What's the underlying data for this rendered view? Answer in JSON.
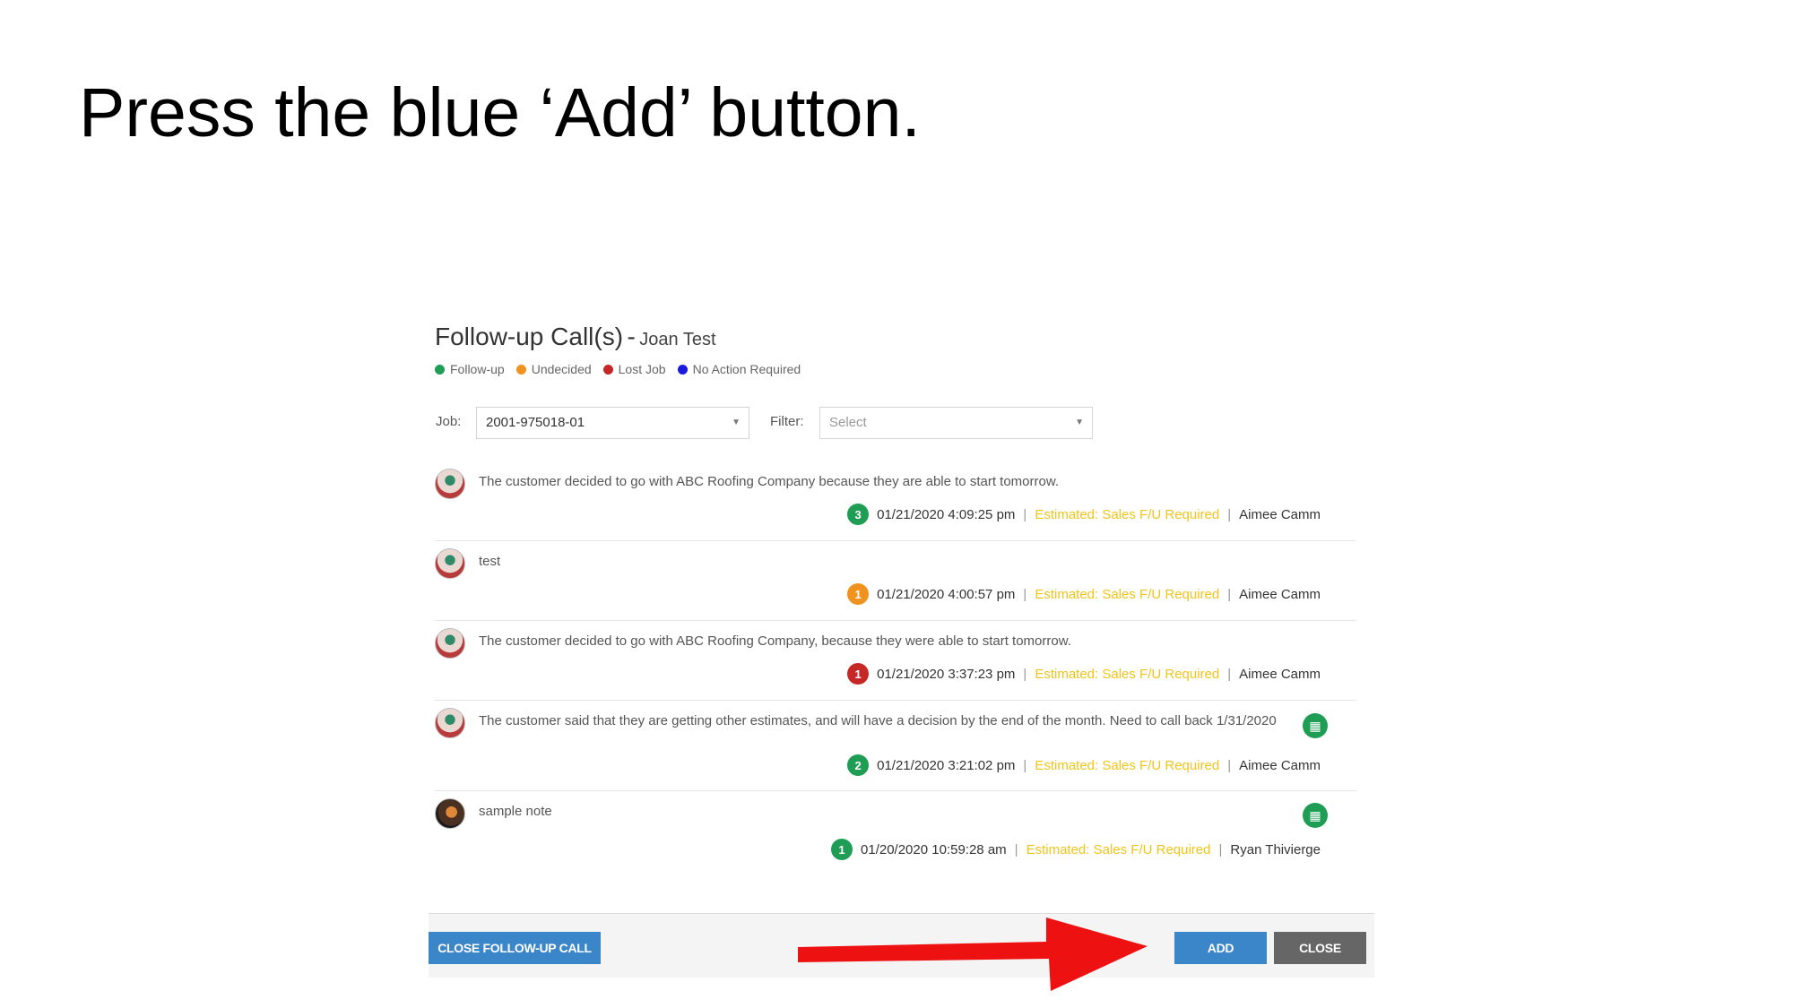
{
  "slide": {
    "instruction": "Press the blue ‘Add’ button."
  },
  "modal": {
    "title": "Follow-up Call(s)",
    "separator": "-",
    "customer": "Joan Test",
    "legend": [
      {
        "label": "Follow-up",
        "color": "#1f9d55"
      },
      {
        "label": "Undecided",
        "color": "#f0931e"
      },
      {
        "label": "Lost Job",
        "color": "#c62828"
      },
      {
        "label": "No Action Required",
        "color": "#1a1ae0"
      }
    ],
    "job": {
      "label": "Job:",
      "value": "2001-975018-01"
    },
    "filter": {
      "label": "Filter:",
      "placeholder": "Select"
    },
    "notes": [
      {
        "text": "The customer decided to go with ABC Roofing Company because they are able to start tomorrow.",
        "badge": "3",
        "badge_color": "#1f9d55",
        "timestamp": "01/21/2020 4:09:25 pm",
        "status": "Estimated: Sales F/U Required",
        "author": "Aimee Camm",
        "calendar": false,
        "avatar": "avatar-icon"
      },
      {
        "text": "test",
        "badge": "1",
        "badge_color": "#f0931e",
        "timestamp": "01/21/2020 4:00:57 pm",
        "status": "Estimated: Sales F/U Required",
        "author": "Aimee Camm",
        "calendar": false,
        "avatar": "avatar-icon"
      },
      {
        "text": "The customer decided to go with ABC Roofing Company, because they were able to start tomorrow.",
        "badge": "1",
        "badge_color": "#c62828",
        "timestamp": "01/21/2020 3:37:23 pm",
        "status": "Estimated: Sales F/U Required",
        "author": "Aimee Camm",
        "calendar": false,
        "avatar": "avatar-icon"
      },
      {
        "text": "The customer said that they are getting other estimates, and will have a decision by the end of the month.  Need to call back 1/31/2020",
        "badge": "2",
        "badge_color": "#1f9d55",
        "timestamp": "01/21/2020 3:21:02 pm",
        "status": "Estimated: Sales F/U Required",
        "author": "Aimee Camm",
        "calendar": true,
        "avatar": "avatar-icon"
      },
      {
        "text": "sample note",
        "badge": "1",
        "badge_color": "#1f9d55",
        "timestamp": "01/20/2020 10:59:28 am",
        "status": "Estimated: Sales F/U Required",
        "author": "Ryan Thivierge",
        "calendar": true,
        "avatar": "avatar-alt-icon"
      }
    ],
    "meta_separator": "|"
  },
  "footer": {
    "close_followup_label": "CLOSE FOLLOW-UP CALL",
    "add_label": "ADD",
    "close_label": "CLOSE"
  },
  "annotation": {
    "icon": "red-arrow-icon",
    "color": "#ee1111"
  },
  "icons": {
    "calendar": "calendar-icon",
    "caret": "chevron-down-icon"
  }
}
